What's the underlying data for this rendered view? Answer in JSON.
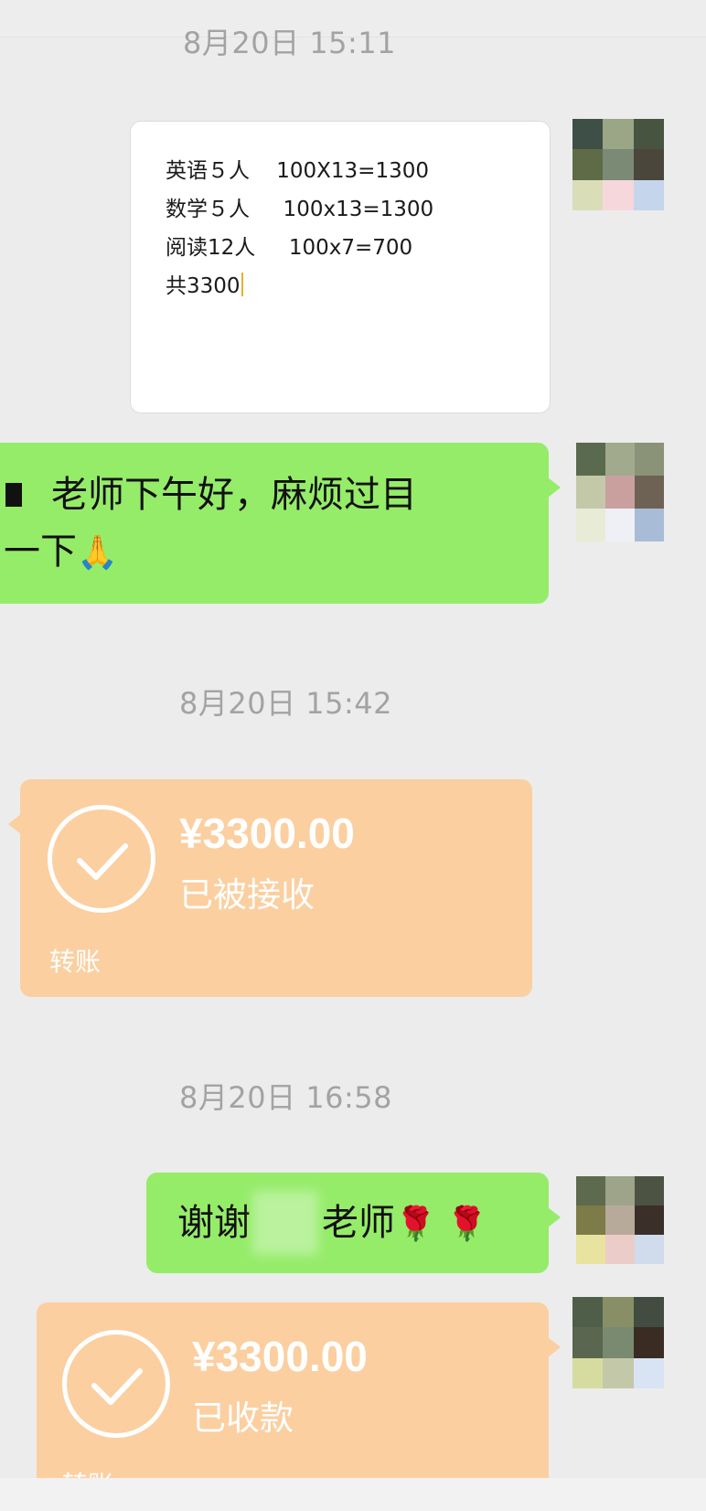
{
  "timestamps": {
    "t1": "8月20日 15:11",
    "t2": "8月20日 15:42",
    "t3": "8月20日 16:58"
  },
  "note_card": {
    "lines": [
      "英语５人    100X13=1300",
      "数学５人     100x13=1300",
      "阅读12人     100x7=700",
      "共3300"
    ]
  },
  "messages": {
    "request": {
      "line1": "老师下午好，麻烦过目",
      "line2": "一下"
    },
    "thanks": {
      "prefix": "谢谢",
      "suffix": "老师",
      "emoji": "🌹 🌹"
    }
  },
  "transfers": [
    {
      "amount": "¥3300.00",
      "status": "已被接收",
      "label": "转账"
    },
    {
      "amount": "¥3300.00",
      "status": "已收款",
      "label": "转账"
    }
  ],
  "emoji": {
    "pray": "🙏"
  },
  "colors": {
    "background": "#ececec",
    "green_bubble": "#95ec69",
    "transfer_bubble": "#fbcfa0",
    "timestamp": "#a3a3a3"
  },
  "icons": [
    "check-circle-icon",
    "avatar-icon"
  ]
}
